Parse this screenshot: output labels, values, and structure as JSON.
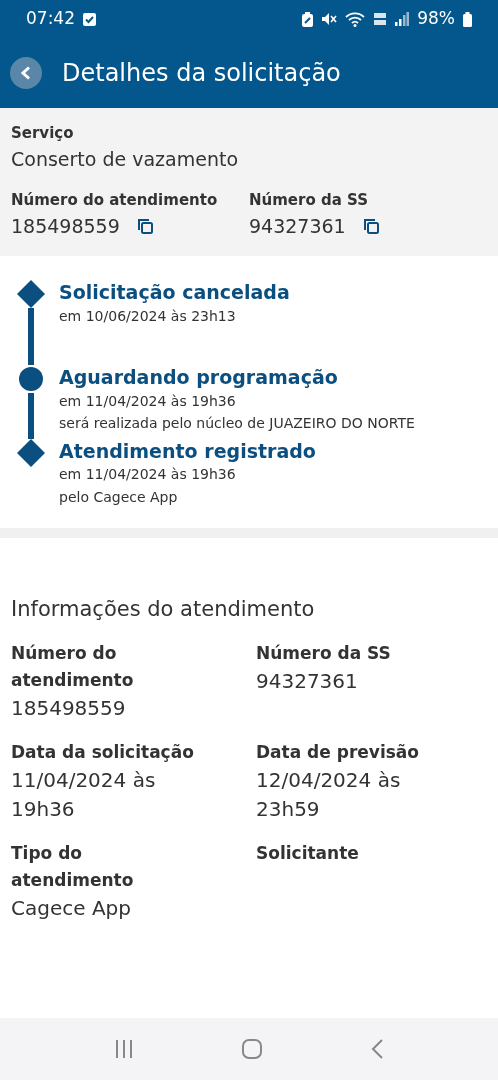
{
  "status_bar": {
    "time": "07:42",
    "battery": "98%"
  },
  "header": {
    "title": "Detalhes da solicitação"
  },
  "summary": {
    "service_label": "Serviço",
    "service_value": "Conserto de vazamento",
    "fields": [
      {
        "label": "Número do atendimento",
        "value": "185498559"
      },
      {
        "label": "Número da SS",
        "value": "94327361"
      }
    ]
  },
  "timeline": [
    {
      "kind": "diamond",
      "title": "Solicitação cancelada",
      "lines": [
        "em 10/06/2024 às 23h13"
      ]
    },
    {
      "kind": "circle",
      "title": "Aguardando programação",
      "lines": [
        "em 11/04/2024 às 19h36",
        "será realizada pelo núcleo de JUAZEIRO DO NORTE"
      ]
    },
    {
      "kind": "diamond",
      "title": "Atendimento registrado",
      "lines": [
        "em 11/04/2024 às 19h36",
        "pelo Cagece App"
      ]
    }
  ],
  "info": {
    "title": "Informações do atendimento",
    "fields": [
      {
        "label": "Número do atendimento",
        "value": "185498559"
      },
      {
        "label": "Número da SS",
        "value": "94327361"
      },
      {
        "label": "Data da solicitação",
        "value": "11/04/2024 às 19h36"
      },
      {
        "label": "Data de previsão",
        "value": "12/04/2024 às 23h59"
      },
      {
        "label": "Tipo do atendimento",
        "value": "Cagece App"
      },
      {
        "label": "Solicitante"
      }
    ]
  }
}
